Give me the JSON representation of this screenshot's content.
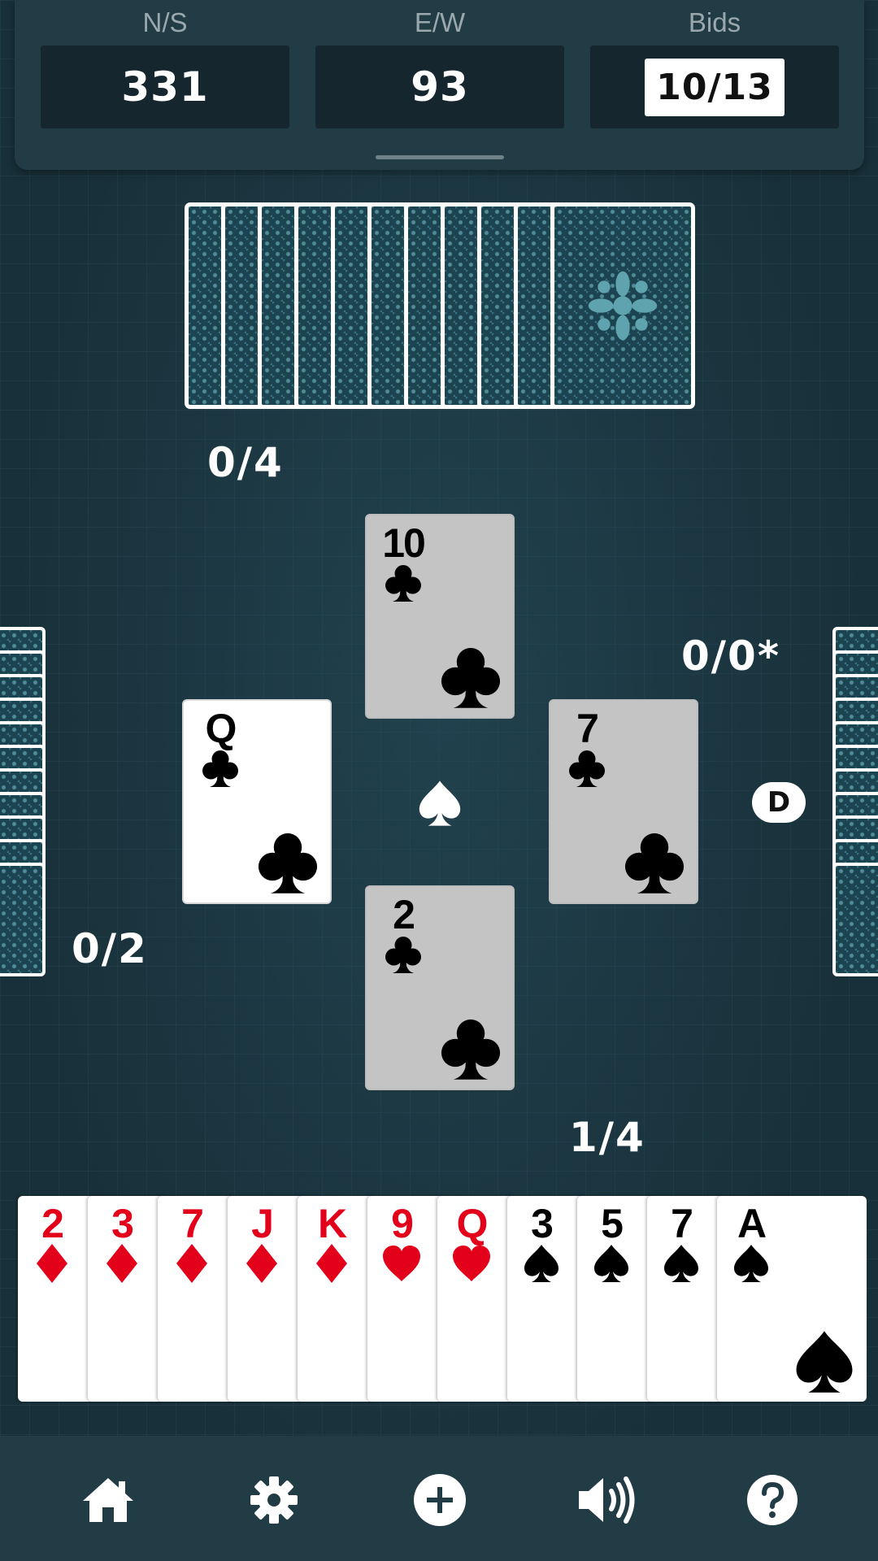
{
  "scoreboard": {
    "ns": {
      "label": "N/S",
      "value": "331"
    },
    "ew": {
      "label": "E/W",
      "value": "93"
    },
    "bids": {
      "label": "Bids",
      "value": "10/13"
    }
  },
  "tricks": {
    "north": "0/4",
    "west": "0/2",
    "east": "0/0*",
    "south": "1/4"
  },
  "hand_counts": {
    "north": 11,
    "west": 11,
    "east": 11
  },
  "trump_suit": "spade",
  "dealer": {
    "seat": "east",
    "label": "D"
  },
  "trick_cards": {
    "north": {
      "rank": "10",
      "suit": "club"
    },
    "west": {
      "rank": "Q",
      "suit": "club"
    },
    "east": {
      "rank": "7",
      "suit": "club"
    },
    "south": {
      "rank": "2",
      "suit": "club"
    }
  },
  "player_hand": [
    {
      "rank": "2",
      "suit": "diamond"
    },
    {
      "rank": "3",
      "suit": "diamond"
    },
    {
      "rank": "7",
      "suit": "diamond"
    },
    {
      "rank": "J",
      "suit": "diamond"
    },
    {
      "rank": "K",
      "suit": "diamond"
    },
    {
      "rank": "9",
      "suit": "heart"
    },
    {
      "rank": "Q",
      "suit": "heart"
    },
    {
      "rank": "3",
      "suit": "spade"
    },
    {
      "rank": "5",
      "suit": "spade"
    },
    {
      "rank": "7",
      "suit": "spade"
    },
    {
      "rank": "A",
      "suit": "spade"
    }
  ],
  "toolbar": [
    {
      "icon": "home-icon"
    },
    {
      "icon": "gear-icon"
    },
    {
      "icon": "plus-circle-icon"
    },
    {
      "icon": "volume-icon"
    },
    {
      "icon": "help-icon"
    }
  ],
  "colors": {
    "red_suit": "#e3001b",
    "black_suit": "#000000",
    "table": "#183039",
    "panel": "#223c46"
  }
}
